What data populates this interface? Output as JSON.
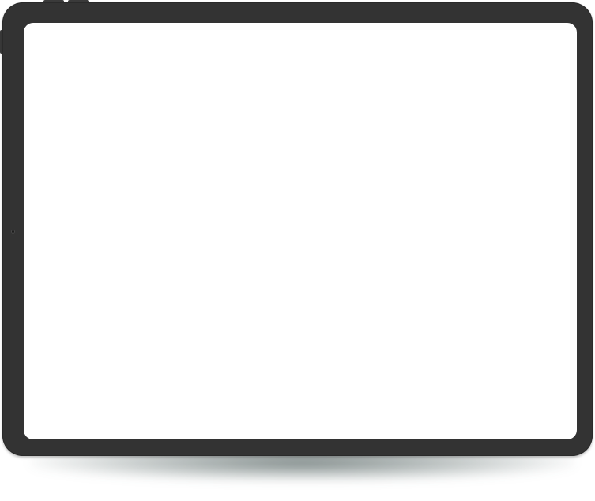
{
  "device": {
    "type": "tablet",
    "orientation": "landscape",
    "frame_color": "#333333",
    "screen_color": "#ffffff",
    "shadow_color": "#2c4a47",
    "icons": {
      "camera": "front-camera-icon"
    }
  }
}
